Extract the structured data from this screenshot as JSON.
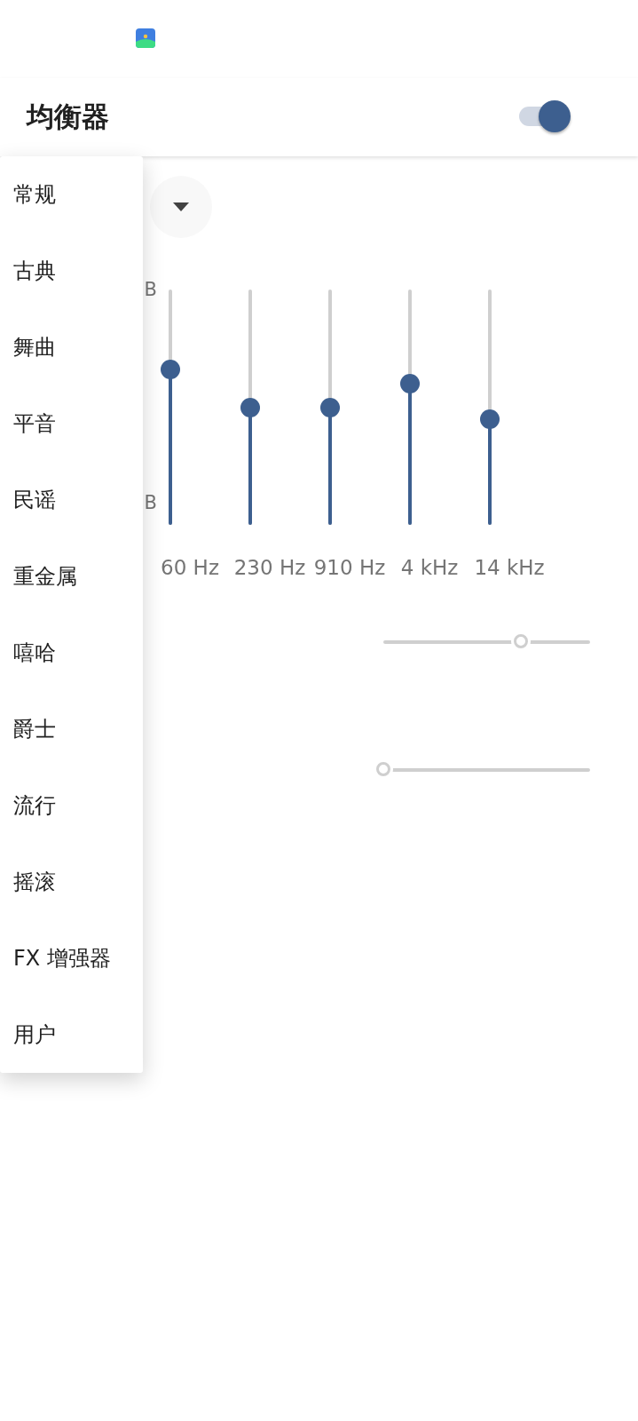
{
  "app_bar": {
    "title": "均衡器",
    "enabled": true
  },
  "preset_dropdown": {
    "expanded": true
  },
  "preset_menu": [
    {
      "label": "常规"
    },
    {
      "label": "古典"
    },
    {
      "label": "舞曲"
    },
    {
      "label": "平音"
    },
    {
      "label": "民谣"
    },
    {
      "label": "重金属"
    },
    {
      "label": "嘻哈"
    },
    {
      "label": "爵士"
    },
    {
      "label": "流行"
    },
    {
      "label": "摇滚"
    },
    {
      "label": "FX 增强器"
    },
    {
      "label": "用户"
    }
  ],
  "equalizer": {
    "scale_top": "B",
    "scale_bottom": "B",
    "bands": [
      {
        "label": "60 Hz",
        "level": 0.66
      },
      {
        "label": "230 Hz",
        "level": 0.5
      },
      {
        "label": "910 Hz",
        "level": 0.5
      },
      {
        "label": "4 kHz",
        "level": 0.6
      },
      {
        "label": "14 kHz",
        "level": 0.45
      }
    ]
  },
  "effect_sliders": [
    {
      "level": 0.665,
      "disabled": true
    },
    {
      "level": 0,
      "disabled": true
    }
  ]
}
